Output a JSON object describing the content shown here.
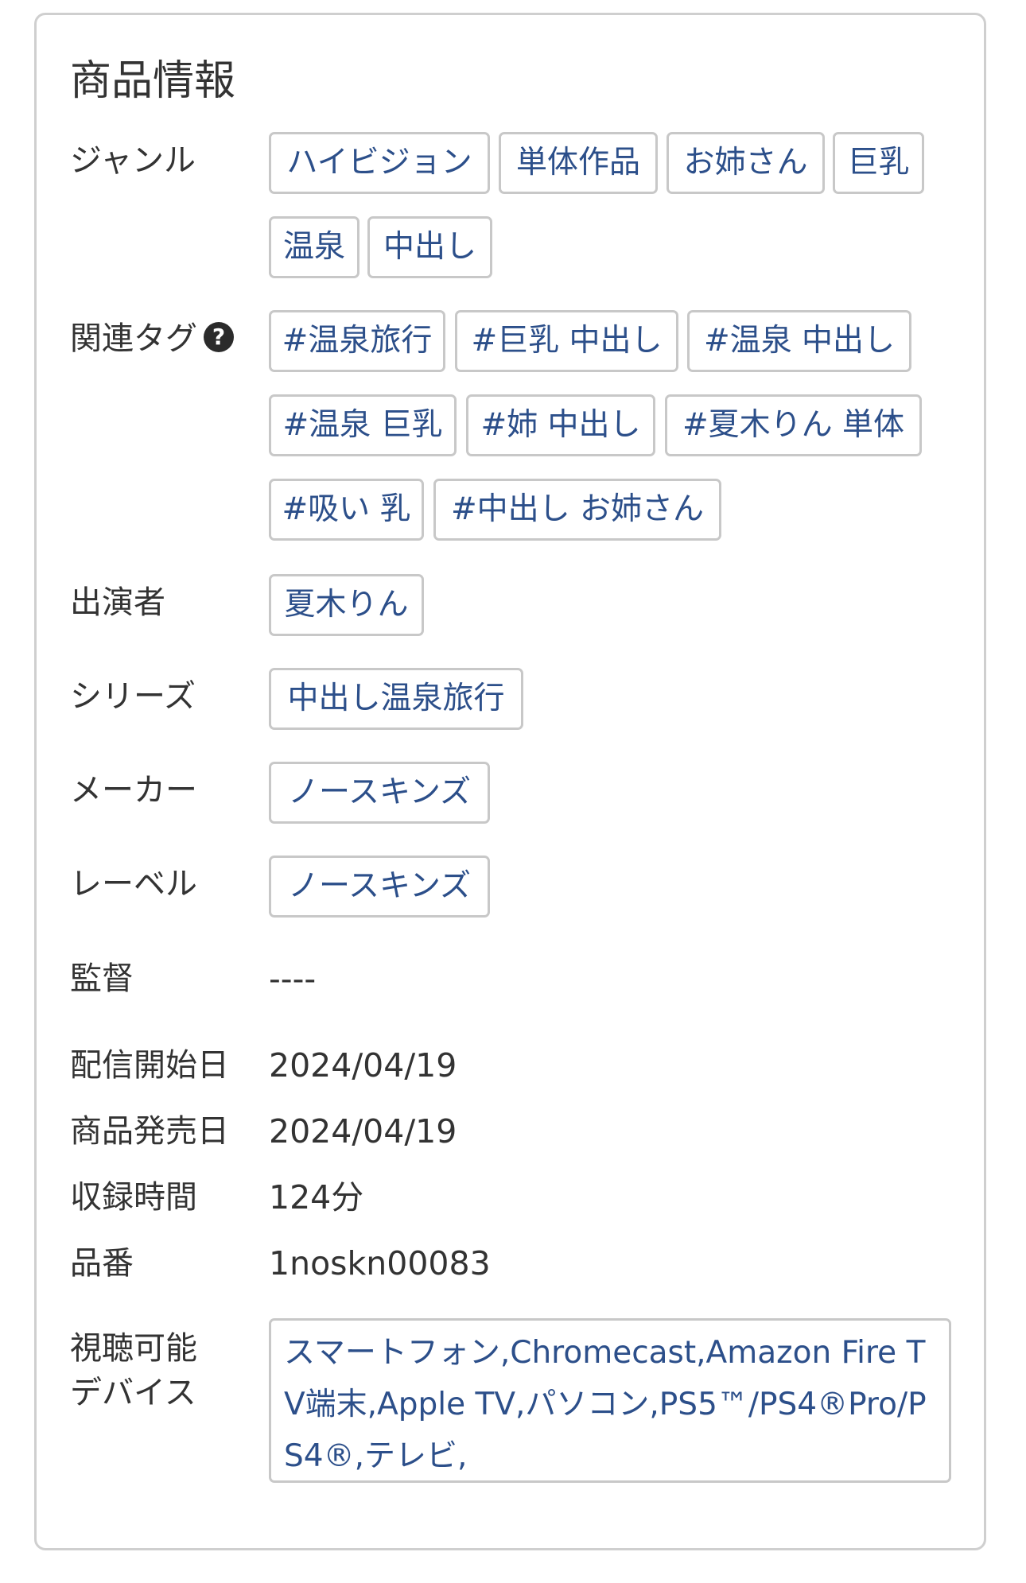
{
  "section_title": "商品情報",
  "genre": {
    "label": "ジャンル",
    "tags": [
      "ハイビジョン",
      "単体作品",
      "お姉さん",
      "巨乳",
      "温泉",
      "中出し"
    ]
  },
  "related_tags": {
    "label": "関連タグ",
    "help_icon": "?",
    "tags": [
      "#温泉旅行",
      "#巨乳 中出し",
      "#温泉 中出し",
      "#温泉 巨乳",
      "#姉 中出し",
      "#夏木りん 単体",
      "#吸い 乳",
      "#中出し お姉さん"
    ]
  },
  "performer": {
    "label": "出演者",
    "tags": [
      "夏木りん"
    ]
  },
  "series": {
    "label": "シリーズ",
    "tags": [
      "中出し温泉旅行"
    ]
  },
  "maker": {
    "label": "メーカー",
    "tags": [
      "ノースキンズ"
    ]
  },
  "publisher_label": {
    "label": "レーベル",
    "tags": [
      "ノースキンズ"
    ]
  },
  "director": {
    "label": "監督",
    "value": "----"
  },
  "delivery_start": {
    "label": "配信開始日",
    "value": "2024/04/19"
  },
  "release_date": {
    "label": "商品発売日",
    "value": "2024/04/19"
  },
  "duration": {
    "label": "収録時間",
    "value": "124分"
  },
  "product_code": {
    "label": "品番",
    "value": "1noskn00083"
  },
  "devices": {
    "label_line1": "視聴可能",
    "label_line2": "デバイス",
    "value": "スマートフォン,Chromecast,Amazon Fire TV端末,Apple TV,パソコン,PS5™/PS4®Pro/PS4®,テレビ,"
  }
}
